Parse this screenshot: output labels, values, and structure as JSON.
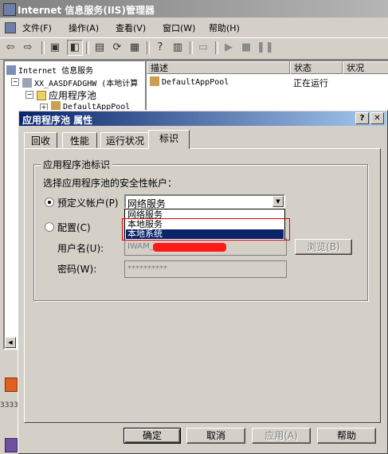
{
  "main_window": {
    "title": "Internet 信息服务(IIS)管理器",
    "menu": [
      "文件(F)",
      "操作(A)",
      "查看(V)",
      "窗口(W)",
      "帮助(H)"
    ]
  },
  "tree": {
    "root": "Internet 信息服务",
    "server": "XX_AASDFADGHW (本地计算",
    "app_pools": "应用程序池",
    "pool": "DefaultAppPool"
  },
  "list": {
    "columns": [
      "描述",
      "状态",
      "状况"
    ],
    "rows": [
      {
        "name": "DefaultAppPool",
        "state": "正在运行",
        "health": ""
      }
    ]
  },
  "left_strip_text": "3333",
  "dialog": {
    "title": "应用程序池 属性",
    "help_btn": "?",
    "close_btn": "✕",
    "tabs": [
      "回收",
      "性能",
      "运行状况",
      "标识"
    ],
    "active_tab": "标识",
    "group_title": "应用程序池标识",
    "prompt": "选择应用程序池的安全性帐户：",
    "predefined_label": "预定义帐户(P)",
    "configurable_label": "配置(C)",
    "combo_value": "网络服务",
    "dropdown_options": [
      "网络服务",
      "本地服务",
      "本地系统"
    ],
    "selected_option": "本地系统",
    "username_label": "用户名(U):",
    "username_value": "IWAM_",
    "password_label": "密码(W):",
    "password_value": "**********",
    "browse_btn": "浏览(B)",
    "ok_btn": "确定",
    "cancel_btn": "取消",
    "apply_btn": "应用(A)",
    "help_button": "帮助"
  },
  "colors": {
    "dialog_title_start": "#0a246a",
    "dialog_title_end": "#a6caf0",
    "selection": "#0a246a",
    "annotation_red": "#e00000"
  }
}
